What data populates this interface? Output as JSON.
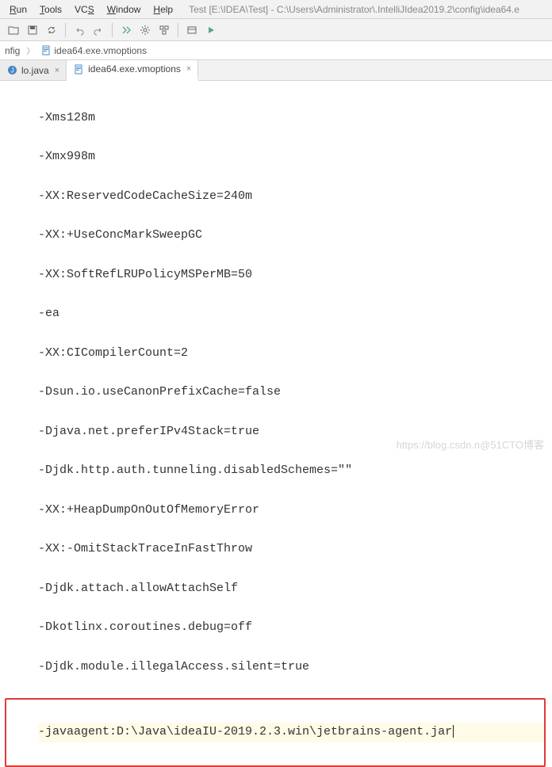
{
  "menu": {
    "run": "Run",
    "tools": "Tools",
    "vcs": "VCS",
    "window": "Window",
    "help": "Help"
  },
  "window_title": "Test [E:\\IDEA\\Test] - C:\\Users\\Administrator\\.IntelliJIdea2019.2\\config\\idea64.e",
  "breadcrumb": {
    "item1": "nfig",
    "item2": "idea64.exe.vmoptions"
  },
  "tabs": {
    "tab1": "lo.java",
    "tab2": "idea64.exe.vmoptions"
  },
  "editor_lines": [
    "-Xms128m",
    "-Xmx998m",
    "-XX:ReservedCodeCacheSize=240m",
    "-XX:+UseConcMarkSweepGC",
    "-XX:SoftRefLRUPolicyMSPerMB=50",
    "-ea",
    "-XX:CICompilerCount=2",
    "-Dsun.io.useCanonPrefixCache=false",
    "-Djava.net.preferIPv4Stack=true",
    "-Djdk.http.auth.tunneling.disabledSchemes=\"\"",
    "-XX:+HeapDumpOnOutOfMemoryError",
    "-XX:-OmitStackTraceInFastThrow",
    "-Djdk.attach.allowAttachSelf",
    "-Dkotlinx.coroutines.debug=off",
    "-Djdk.module.illegalAccess.silent=true"
  ],
  "highlighted_line": "-javaagent:D:\\Java\\ideaIU-2019.2.3.win\\jetbrains-agent.jar",
  "watermark": "https://blog.csdn.n@51CTO博客"
}
